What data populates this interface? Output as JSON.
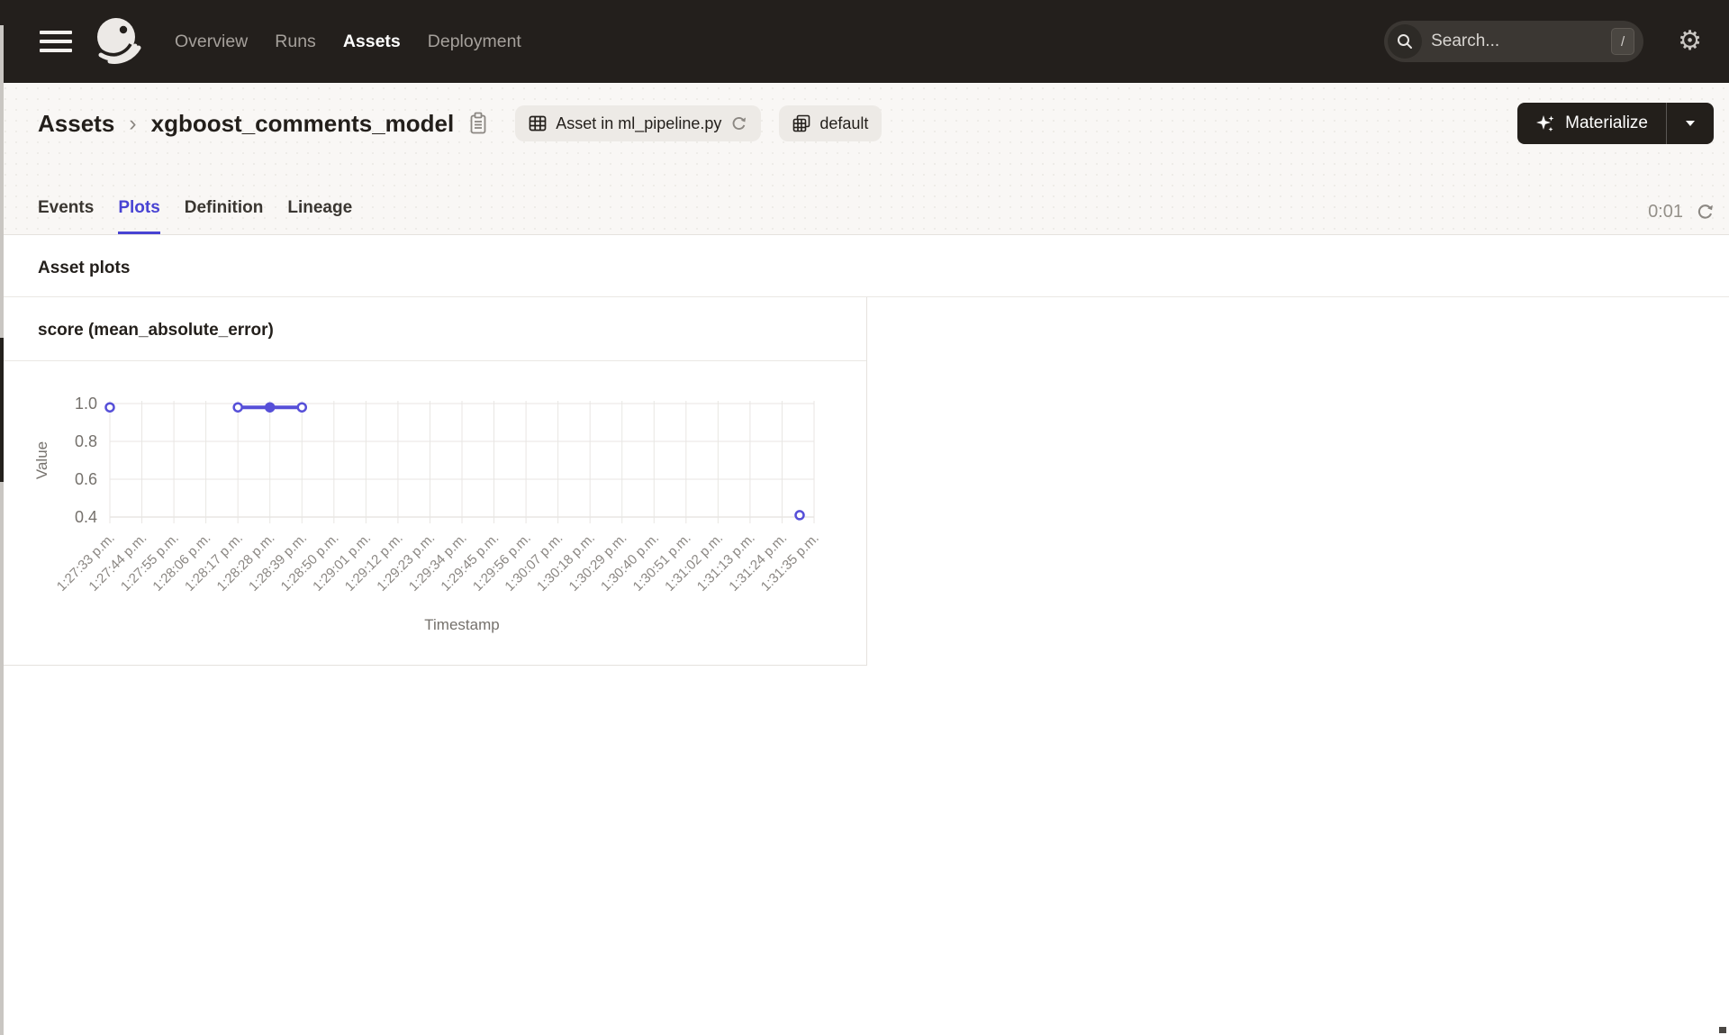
{
  "nav": {
    "items": [
      {
        "label": "Overview",
        "active": false
      },
      {
        "label": "Runs",
        "active": false
      },
      {
        "label": "Assets",
        "active": true
      },
      {
        "label": "Deployment",
        "active": false
      }
    ],
    "search": {
      "placeholder": "Search...",
      "shortcut": "/"
    }
  },
  "breadcrumb": {
    "root": "Assets",
    "separator": "›",
    "current": "xgboost_comments_model"
  },
  "badges": {
    "code_location": "Asset in ml_pipeline.py",
    "group": "default"
  },
  "materialize": {
    "label": "Materialize"
  },
  "tabs": {
    "items": [
      {
        "label": "Events",
        "active": false
      },
      {
        "label": "Plots",
        "active": true
      },
      {
        "label": "Definition",
        "active": false
      },
      {
        "label": "Lineage",
        "active": false
      }
    ],
    "timer": "0:01"
  },
  "section": {
    "title": "Asset plots"
  },
  "colors": {
    "nav_bg": "#231f1c",
    "accent": "#4843d3",
    "chart_line": "#564fd8",
    "header_bg": "#f9f7f5"
  },
  "chart_data": {
    "type": "line",
    "title": "score (mean_absolute_error)",
    "xlabel": "Timestamp",
    "ylabel": "Value",
    "ylim": [
      0.4,
      1.0
    ],
    "yticks": [
      1.0,
      0.8,
      0.6,
      0.4
    ],
    "grid": true,
    "legend": false,
    "x_tick_labels": [
      "1:27:33 p.m.",
      "1:27:44 p.m.",
      "1:27:55 p.m.",
      "1:28:06 p.m.",
      "1:28:17 p.m.",
      "1:28:28 p.m.",
      "1:28:39 p.m.",
      "1:28:50 p.m.",
      "1:29:01 p.m.",
      "1:29:12 p.m.",
      "1:29:23 p.m.",
      "1:29:34 p.m.",
      "1:29:45 p.m.",
      "1:29:56 p.m.",
      "1:30:07 p.m.",
      "1:30:18 p.m.",
      "1:30:29 p.m.",
      "1:30:40 p.m.",
      "1:30:51 p.m.",
      "1:31:02 p.m.",
      "1:31:13 p.m.",
      "1:31:24 p.m.",
      "1:31:35 p.m."
    ],
    "points": [
      {
        "xi": 0,
        "v": 0.98,
        "filled": false
      },
      {
        "xi": 4,
        "v": 0.98,
        "filled": false
      },
      {
        "xi": 5,
        "v": 0.98,
        "filled": true
      },
      {
        "xi": 6,
        "v": 0.98,
        "filled": false
      },
      {
        "xi": 21.55,
        "v": 0.41,
        "filled": false
      }
    ],
    "segments": [
      [
        1,
        2,
        3
      ]
    ],
    "colors": {
      "line": "#564fd8",
      "grid": "#e8e6e3",
      "axis": "#dcd9d5",
      "tick_text": "#8b8783",
      "label_text": "#75716c"
    }
  }
}
